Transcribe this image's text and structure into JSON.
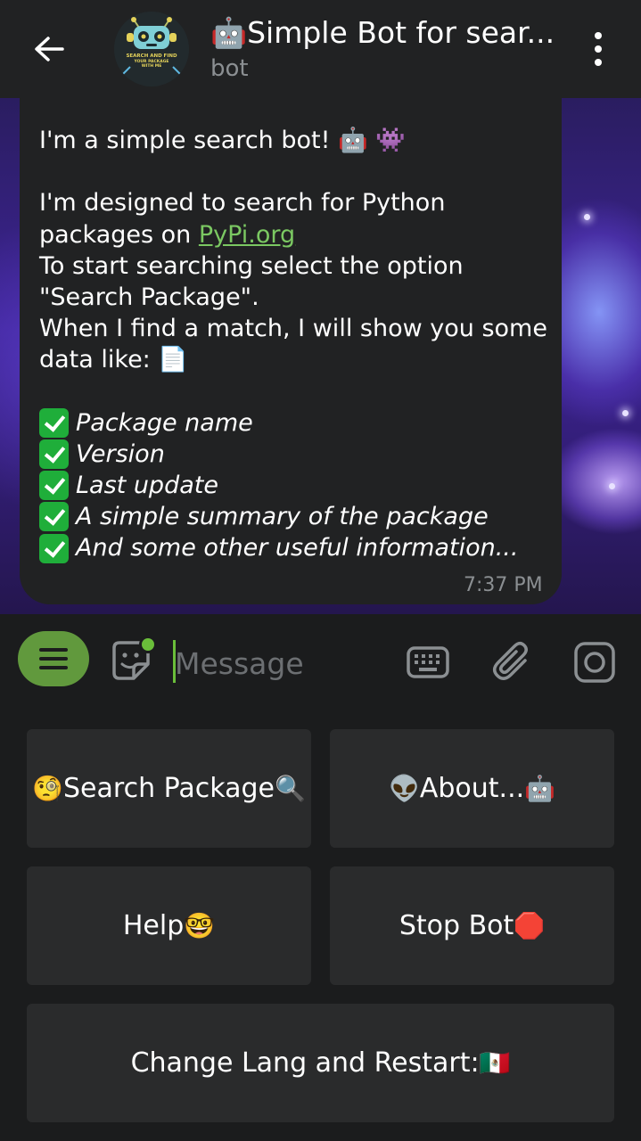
{
  "header": {
    "title": "🤖Simple Bot for sear...",
    "subtitle": "bot",
    "avatar_text_lines": [
      "SEARCH AND FIND",
      "YOUR PACKAGE",
      "WITH ME"
    ]
  },
  "message": {
    "intro": "I'm a simple search bot! 🤖 👾",
    "line_designed": "I'm designed to search for Python",
    "line_packages_prefix": "packages on ",
    "link_text": "PyPi.org",
    "line_start": "To start searching select the option",
    "line_option": "\"Search Package\".",
    "line_match": "When I find a match, I will show you some",
    "line_data": "data like: 📄",
    "items": [
      "Package name",
      "Version",
      "Last update",
      "A simple summary of the package",
      "And some other useful information..."
    ],
    "time": "7:37 PM"
  },
  "input": {
    "placeholder": "Message"
  },
  "keyboard": {
    "search": {
      "label": "Search Package",
      "emoji_before": "🧐",
      "emoji_after": "🔍"
    },
    "about": {
      "label": "About...",
      "emoji_before": "👽",
      "emoji_after": "🤖"
    },
    "help": {
      "label": "Help",
      "emoji_after": "🤓"
    },
    "stop": {
      "label": "Stop Bot",
      "emoji_after": "🛑"
    },
    "change_lang": {
      "label": "Change Lang and Restart: ",
      "emoji_after": "🇲🇽"
    }
  },
  "colors": {
    "accent_green": "#61993d",
    "link_green": "#7bc862",
    "header_bg": "#212223",
    "button_bg": "#2a2b2c"
  },
  "icons": {
    "back": "arrow-left-icon",
    "menu": "vertical-dots-icon",
    "sticker": "sticker-icon",
    "keyboard": "keyboard-icon",
    "attach": "paperclip-icon",
    "camera": "instagram-camera-icon",
    "bot_menu": "hamburger-icon"
  }
}
